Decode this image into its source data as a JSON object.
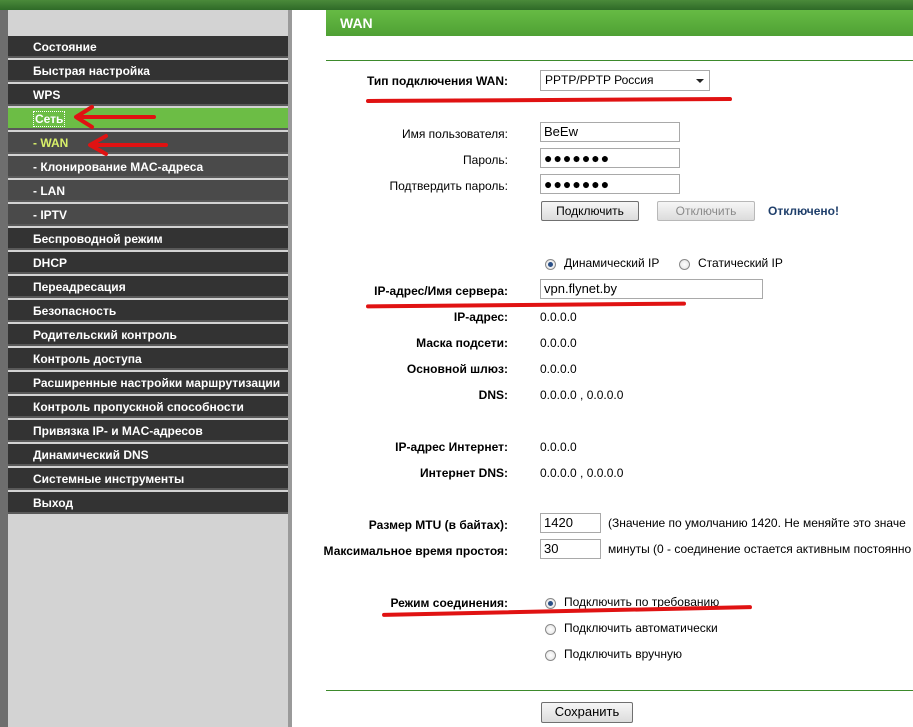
{
  "sidebar": {
    "items": [
      {
        "label": "Состояние",
        "type": "main"
      },
      {
        "label": "Быстрая настройка",
        "type": "main"
      },
      {
        "label": "WPS",
        "type": "main"
      },
      {
        "label": "Сеть",
        "type": "active"
      },
      {
        "label": "- WAN",
        "type": "sub-active"
      },
      {
        "label": "- Клонирование MAC-адреса",
        "type": "sub"
      },
      {
        "label": "- LAN",
        "type": "sub"
      },
      {
        "label": "- IPTV",
        "type": "sub"
      },
      {
        "label": "Беспроводной режим",
        "type": "main"
      },
      {
        "label": "DHCP",
        "type": "main"
      },
      {
        "label": "Переадресация",
        "type": "main"
      },
      {
        "label": "Безопасность",
        "type": "main"
      },
      {
        "label": "Родительский контроль",
        "type": "main"
      },
      {
        "label": "Контроль доступа",
        "type": "main"
      },
      {
        "label": "Расширенные настройки маршрутизации",
        "type": "main"
      },
      {
        "label": "Контроль пропускной способности",
        "type": "main"
      },
      {
        "label": "Привязка IP- и MAC-адресов",
        "type": "main"
      },
      {
        "label": "Динамический DNS",
        "type": "main"
      },
      {
        "label": "Системные инструменты",
        "type": "main"
      },
      {
        "label": "Выход",
        "type": "main"
      }
    ]
  },
  "header": {
    "title": "WAN"
  },
  "form": {
    "conn_type_label": "Тип подключения WAN:",
    "conn_type_value": "PPTP/PPTP Россия",
    "username_label": "Имя пользователя:",
    "username_value": "BeEw",
    "password_label": "Пароль:",
    "password_value": "●●●●●●●",
    "confirm_label": "Подтвердить пароль:",
    "confirm_value": "●●●●●●●",
    "connect_btn": "Подключить",
    "disconnect_btn": "Отключить",
    "status_text": "Отключено!",
    "dynamic_ip": "Динамический IP",
    "static_ip": "Статический IP",
    "server_label": "IP-адрес/Имя сервера:",
    "server_value": "vpn.flynet.by",
    "ip_label": "IP-адрес:",
    "ip_value": "0.0.0.0",
    "mask_label": "Маска подсети:",
    "mask_value": "0.0.0.0",
    "gateway_label": "Основной шлюз:",
    "gateway_value": "0.0.0.0",
    "dns_label": "DNS:",
    "dns_value": "0.0.0.0 , 0.0.0.0",
    "inet_ip_label": "IP-адрес Интернет:",
    "inet_ip_value": "0.0.0.0",
    "inet_dns_label": "Интернет DNS:",
    "inet_dns_value": "0.0.0.0 , 0.0.0.0",
    "mtu_label": "Размер MTU (в байтах):",
    "mtu_value": "1420",
    "mtu_hint": "(Значение по умолчанию 1420. Не меняйте это значе",
    "idle_label": "Максимальное время простоя:",
    "idle_value": "30",
    "idle_hint": "минуты (0 - соединение остается активным постоянно",
    "mode_label": "Режим соединения:",
    "mode_demand": "Подключить по требованию",
    "mode_auto": "Подключить автоматически",
    "mode_manual": "Подключить вручную",
    "save_btn": "Сохранить"
  },
  "colors": {
    "accent": "#6cbd45",
    "nav_bg": "#333333",
    "annotation": "#e01212",
    "status": "#1f3f6b"
  }
}
